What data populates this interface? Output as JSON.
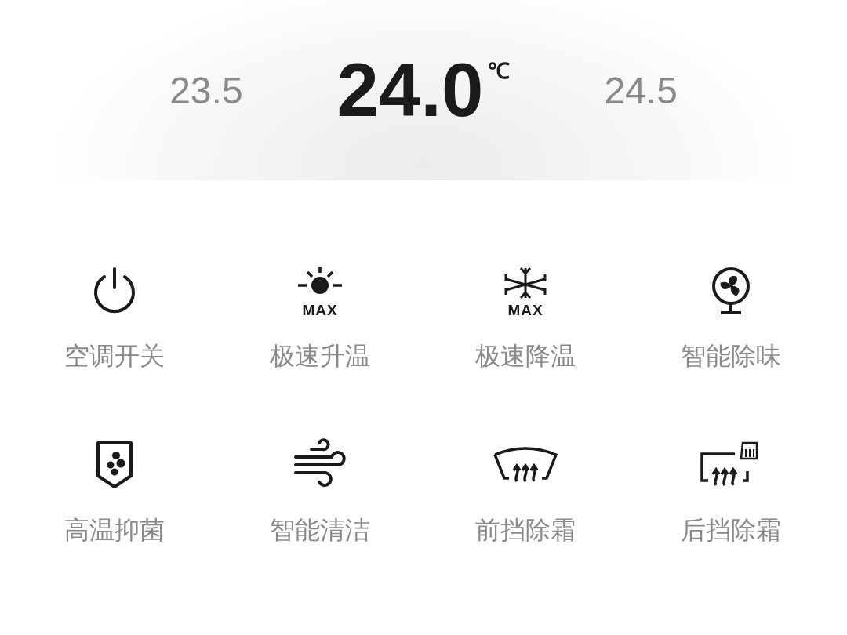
{
  "temperatures": [
    {
      "value": "23.5",
      "selected": false
    },
    {
      "value": "24.0",
      "unit": "℃",
      "selected": true
    },
    {
      "value": "24.5",
      "selected": false
    }
  ],
  "functions": [
    {
      "kind": "power",
      "label": "空调开关"
    },
    {
      "kind": "heat",
      "badge": "MAX",
      "label": "极速升温"
    },
    {
      "kind": "cool",
      "badge": "MAX",
      "label": "极速降温"
    },
    {
      "kind": "fan",
      "label": "智能除味"
    },
    {
      "kind": "shield",
      "label": "高温抑菌"
    },
    {
      "kind": "wind",
      "label": "智能清洁"
    },
    {
      "kind": "front-defrost",
      "label": "前挡除霜"
    },
    {
      "kind": "rear-defrost",
      "label": "后挡除霜"
    }
  ]
}
